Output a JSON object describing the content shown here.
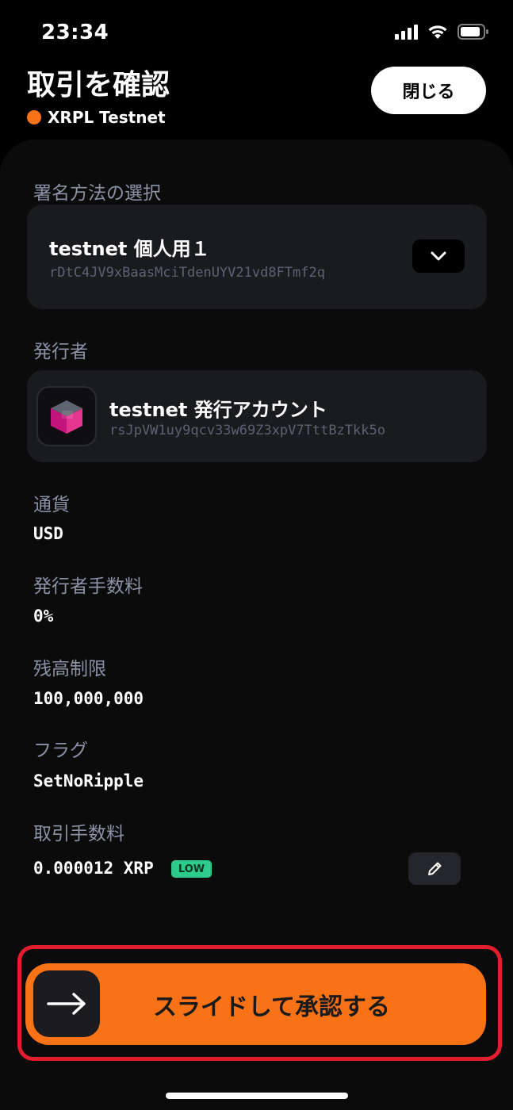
{
  "status_bar": {
    "time": "23:34"
  },
  "header": {
    "title": "取引を確認",
    "network": "XRPL Testnet",
    "close_label": "閉じる"
  },
  "signing": {
    "label": "署名方法の選択",
    "account_name": "testnet 個人用１",
    "account_address": "rDtC4JV9xBaasMciTdenUYV21vd8FTmf2q"
  },
  "issuer": {
    "label": "発行者",
    "account_name": "testnet 発行アカウント",
    "account_address": "rsJpVW1uy9qcv33w69Z3xpV7TttBzTkk5o"
  },
  "fields": {
    "currency_label": "通貨",
    "currency_value": "USD",
    "issuer_fee_label": "発行者手数料",
    "issuer_fee_value": "0%",
    "limit_label": "残高制限",
    "limit_value": "100,000,000",
    "flags_label": "フラグ",
    "flags_value": "SetNoRipple",
    "tx_fee_label": "取引手数料",
    "tx_fee_value": "0.000012 XRP",
    "tx_fee_badge": "LOW"
  },
  "slider": {
    "label": "スライドして承認する"
  },
  "colors": {
    "accent": "#F97316",
    "card": "#1a1b1f",
    "highlight": "#e11d2e",
    "badge": "#2ecc8b"
  }
}
